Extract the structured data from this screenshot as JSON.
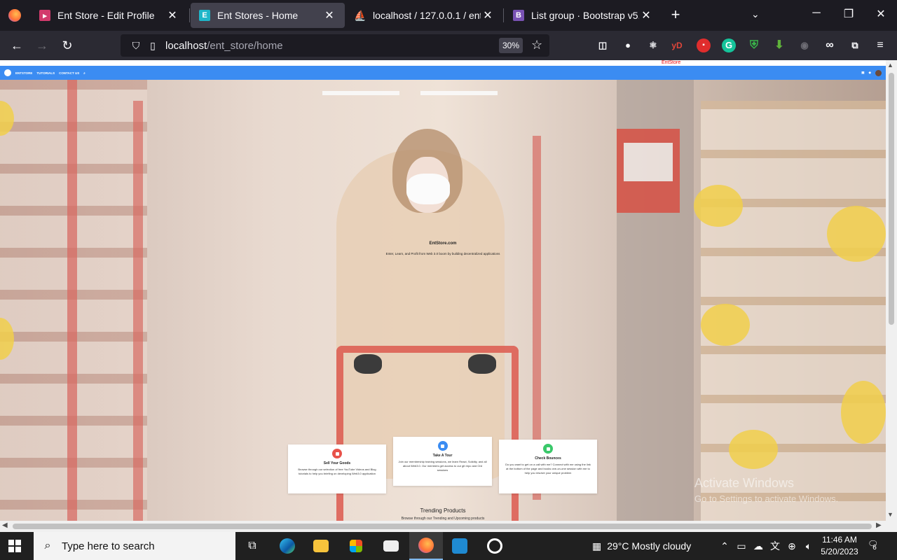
{
  "browser": {
    "tabs": [
      {
        "title": "Ent Store - Edit Profile",
        "active": false,
        "favicon_color": "#d23a6c"
      },
      {
        "title": "Ent Stores - Home",
        "active": true,
        "favicon_color": "#1fb6c9"
      },
      {
        "title": "localhost / 127.0.0.1 / ent_store",
        "active": false,
        "favicon_color": "#e9a33a"
      },
      {
        "title": "List group · Bootstrap v5.1",
        "active": false,
        "favicon_color": "#7952b3"
      }
    ],
    "url_host": "localhost",
    "url_path": "/ent_store/home",
    "zoom": "30%",
    "extensions": [
      "pocket-icon",
      "account-icon",
      "react-icon",
      "yandex-icon",
      "lock-icon",
      "grammarly-icon",
      "shield-icon",
      "download-icon",
      "circle-icon",
      "infinity-icon",
      "extensions-icon",
      "menu-icon"
    ]
  },
  "site": {
    "top_badge": "EntStore",
    "nav": [
      "ENTSTORE",
      "TUTORIALS",
      "CONTACT US"
    ],
    "hero_title": "EntStore.com",
    "hero_subtitle": "Enter, Learn, and Profit from Web 3.0 boom by building decentralized applications",
    "cards": [
      {
        "title": "Sell Your Goods",
        "body": "Browse through our selection of free YouTube Videos and Blog tutorials to help you briefing on developing Web3.0 application",
        "color": "#e8524a"
      },
      {
        "title": "Take A Tour",
        "body": "Join our membership training sessions, we learn React, Solidity, and all about Web3.0. Our members get access to our git repo and Ord sessions",
        "color": "#3b8cf2"
      },
      {
        "title": "Check Bounces",
        "body": "Do you want to get on a call with me? Connect with me using the link at the bottom of the page and books one-on-one session with me to help you resolve your unique problem",
        "color": "#3ac86a"
      }
    ],
    "trending_title": "Trending Products",
    "trending_sub": "Browse through our Trending and Upcoming products"
  },
  "watermark": {
    "line1": "Activate Windows",
    "line2": "Go to Settings to activate Windows."
  },
  "taskbar": {
    "search_placeholder": "Type here to search",
    "weather": "29°C  Mostly cloudy",
    "time": "11:46 AM",
    "date": "5/20/2023",
    "notifications": "6"
  }
}
